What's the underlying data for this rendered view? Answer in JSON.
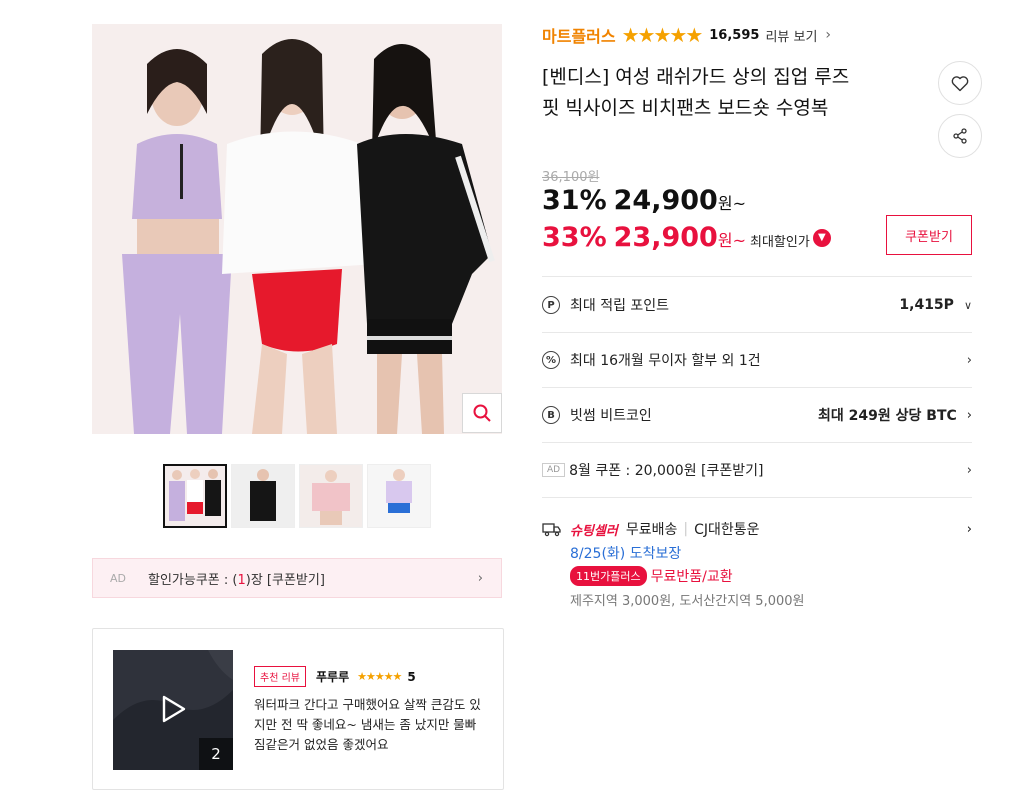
{
  "brand": {
    "name": "마트플러스",
    "rating_stars": 5,
    "review_count": "16,595",
    "review_link": "리뷰 보기"
  },
  "product": {
    "title_line1": "[벤디스] 여성 래쉬가드 상의 집업 루즈",
    "title_line2": "핏 빅사이즈 비치팬츠 보드숏 수영복"
  },
  "price": {
    "original": "36,100원",
    "discount1_pct": "31%",
    "discount1_price": "24,900",
    "discount1_unit": "원~",
    "discount2_pct": "33%",
    "discount2_price": "23,900",
    "discount2_unit": "원~",
    "max_discount_label": "최대할인가",
    "coupon_button": "쿠폰받기"
  },
  "rows": [
    {
      "icon": "P",
      "label": "최대 적립 포인트",
      "value": "1,415P"
    },
    {
      "icon": "%",
      "label": "최대 16개월 무이자 할부 외 1건",
      "value": ""
    },
    {
      "icon": "B",
      "label": "빗썸 비트코인",
      "value": "최대 249원 상당 BTC"
    },
    {
      "icon": "AD",
      "label": "8월 쿠폰 : 20,000원 [쿠폰받기]",
      "value": ""
    }
  ],
  "shipping": {
    "badge": "슈팅셀러",
    "free": "무료배송",
    "carrier": "CJ대한통운",
    "eta": "8/25(화) 도착보장",
    "plus_badge": "11번가플러스",
    "returns": "무료반품/교환",
    "extra_fee": "제주지역 3,000원, 도서산간지역 5,000원"
  },
  "coupon_bar": {
    "ad": "AD",
    "text_prefix": "할인가능쿠폰 : (",
    "count": "1",
    "text_suffix": ")장 [쿠폰받기]"
  },
  "review": {
    "badge": "추천 리뷰",
    "author": "푸루루",
    "score": "5",
    "text": "워터파크 간다고 구매했어요 살짝 큰감도 있지만 전 딱 좋네요~ 냄새는 좀 났지만 물빠짐같은거 없었음 좋겠어요",
    "media_count": "2"
  },
  "colors": {
    "brand_orange": "#f08300",
    "accent_red": "#e8113e",
    "eta_blue": "#2a6fd6",
    "star": "#f5a100"
  },
  "icons": [
    "heart-icon",
    "share-icon",
    "search-icon",
    "truck-icon",
    "play-icon",
    "chevron-right-icon",
    "chevron-down-icon"
  ]
}
